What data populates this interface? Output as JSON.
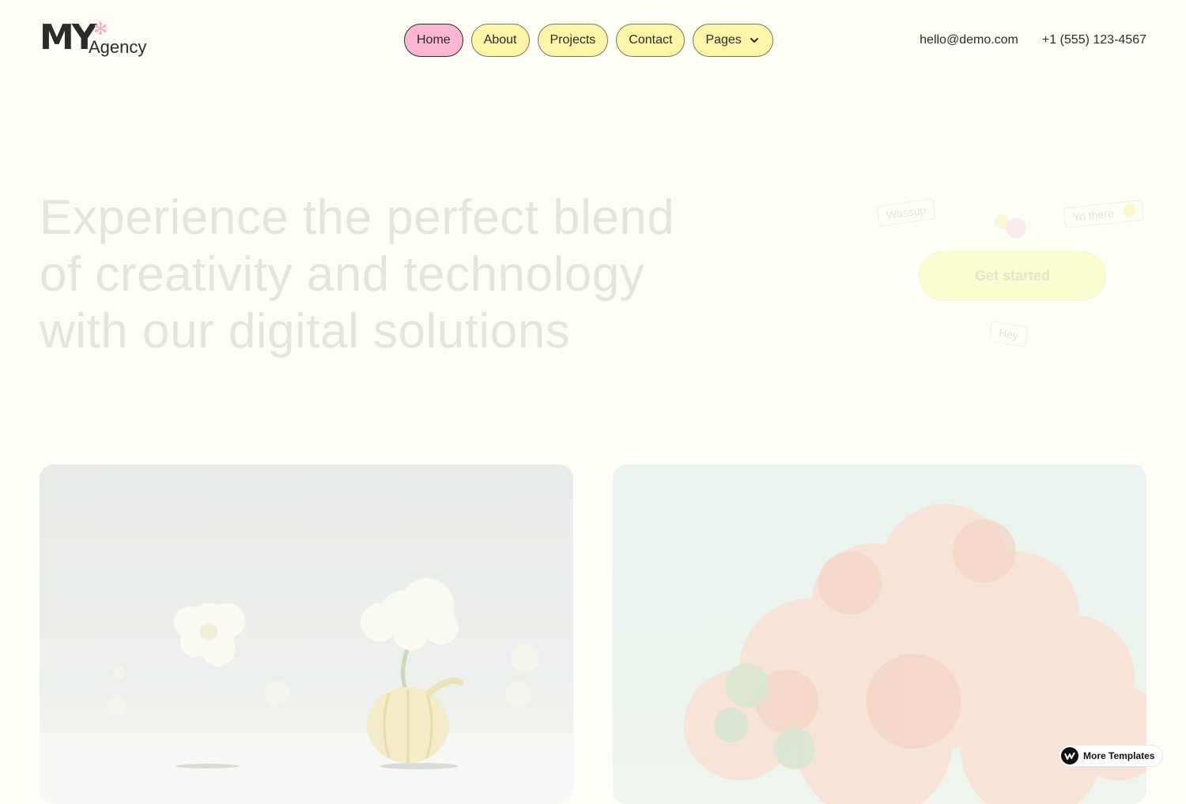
{
  "brand": {
    "mark": "MY",
    "name": "Agency",
    "accent_color": "#f9a8c8"
  },
  "nav": {
    "items": [
      {
        "label": "Home",
        "active": true
      },
      {
        "label": "About",
        "active": false
      },
      {
        "label": "Projects",
        "active": false
      },
      {
        "label": "Contact",
        "active": false
      },
      {
        "label": "Pages",
        "active": false,
        "icon": "chevron-down-icon"
      }
    ],
    "colors": {
      "default": "#fdf5a6",
      "active": "#fcb6d2"
    }
  },
  "contact": {
    "email": "hello@demo.com",
    "phone": "+1 (555) 123-4567"
  },
  "hero": {
    "headline": "Experience the perfect blend of creativity and technology with our digital solutions",
    "bubbles": [
      "Wassup",
      "Yo there",
      "Hey"
    ],
    "cta_label": "Get started"
  },
  "cards": [
    {
      "name": "white-flowers-image"
    },
    {
      "name": "coral-cloud-image"
    }
  ],
  "badge": {
    "label": "More Templates",
    "icon": "webflow-logo-icon"
  },
  "colors": {
    "background": "#fdfff6",
    "text": "#1c1c1c",
    "headline_faded": "#e4e5df"
  }
}
